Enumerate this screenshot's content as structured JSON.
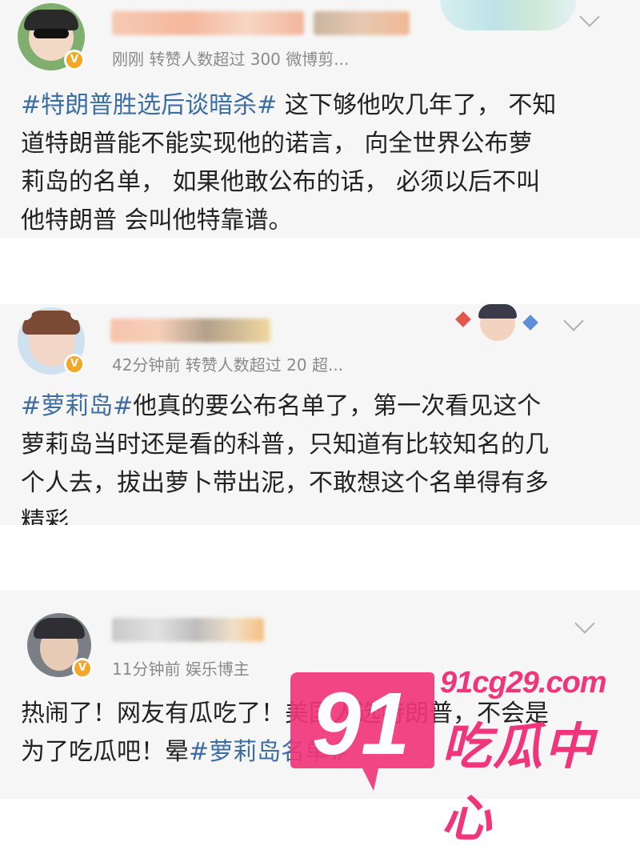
{
  "posts": [
    {
      "meta": "刚刚 转赞人数超过 300 微博剪...",
      "topic": "#特朗普胜选后谈暗杀#",
      "lines": [
        " 这下够他吹几年了， 不知",
        "道特朗普能不能实现他的诺言， 向全世界公布萝",
        "莉岛的名单， 如果他敢公布的话， 必须以后不叫",
        "他特朗普 会叫他特靠谱。"
      ]
    },
    {
      "meta": "42分钟前 转赞人数超过 20 超...",
      "topic": "#萝莉岛#",
      "lines": [
        "他真的要公布名单了，第一次看见这个",
        "萝莉岛当时还是看的科普，只知道有比较知名的几",
        "个人去，拔出萝卜带出泥，不敢想这个名单得有多",
        "精彩"
      ]
    },
    {
      "meta": "11分钟前 娱乐博主",
      "line1": "热闹了！网友有瓜吃了！美国人选特朗普，不会是",
      "line2_prefix": "为了吃瓜吧！晕",
      "topic": "#萝莉岛名单#"
    }
  ],
  "watermark": {
    "logo_number": "91",
    "url": "91cg29.com",
    "title": "吃瓜中心",
    "color": "#f0357a"
  },
  "icons": [
    "verified-badge-icon",
    "chevron-down-icon"
  ]
}
